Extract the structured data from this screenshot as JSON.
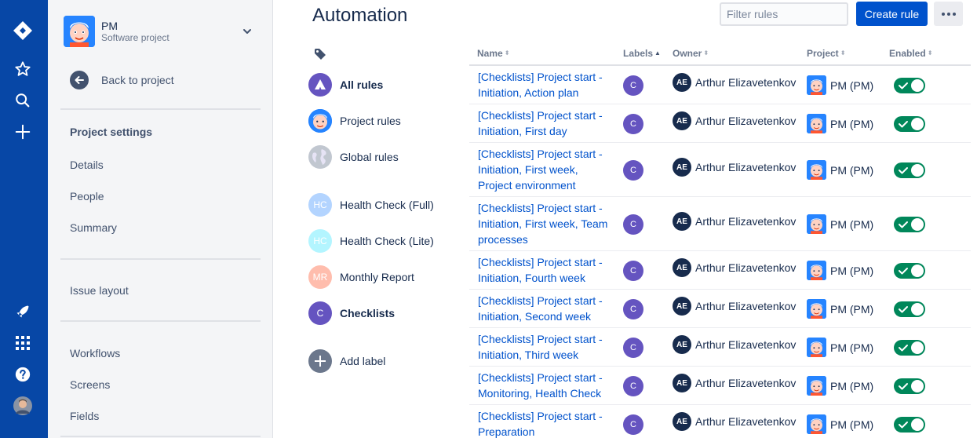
{
  "sidebar": {
    "project_name": "PM",
    "project_type": "Software project",
    "back_label": "Back to project",
    "section_heading": "Project settings",
    "items_a": [
      "Details",
      "People",
      "Summary"
    ],
    "issue_layout": "Issue layout",
    "items_b": [
      "Workflows",
      "Screens",
      "Fields"
    ]
  },
  "header": {
    "title": "Automation",
    "filter_placeholder": "Filter rules",
    "create_label": "Create rule"
  },
  "labels_panel": {
    "items": [
      {
        "label": "All rules",
        "icon": "automation-logo-icon",
        "bold": true
      },
      {
        "label": "Project rules",
        "icon": "project-avatar-icon",
        "bold": false
      },
      {
        "label": "Global rules",
        "icon": "globe-icon",
        "bold": false
      }
    ],
    "labels": [
      {
        "label": "Health Check (Full)",
        "initials": "HC",
        "color": "#b3d4ff",
        "bold": false
      },
      {
        "label": "Health Check (Lite)",
        "initials": "HC",
        "color": "#b3f5ff",
        "bold": false
      },
      {
        "label": "Monthly Report",
        "initials": "MR",
        "color": "#ffbdad",
        "bold": false
      },
      {
        "label": "Checklists",
        "initials": "C",
        "color": "#6554c0",
        "bold": true
      }
    ],
    "add_label": "Add label"
  },
  "table": {
    "columns": [
      "Name",
      "Labels",
      "Owner",
      "Project",
      "Enabled"
    ],
    "rows": [
      {
        "name": "[Checklists] Project start - Initiation, Action plan",
        "label": "C",
        "owner_initials": "AE",
        "owner": "Arthur Elizavetenkov",
        "project": "PM (PM)",
        "enabled": true
      },
      {
        "name": "[Checklists] Project start - Initiation, First day",
        "label": "C",
        "owner_initials": "AE",
        "owner": "Arthur Elizavetenkov",
        "project": "PM (PM)",
        "enabled": true
      },
      {
        "name": "[Checklists] Project start - Initiation, First week, Project environment",
        "label": "C",
        "owner_initials": "AE",
        "owner": "Arthur Elizavetenkov",
        "project": "PM (PM)",
        "enabled": true
      },
      {
        "name": "[Checklists] Project start - Initiation, First week, Team processes",
        "label": "C",
        "owner_initials": "AE",
        "owner": "Arthur Elizavetenkov",
        "project": "PM (PM)",
        "enabled": true
      },
      {
        "name": "[Checklists] Project start - Initiation, Fourth week",
        "label": "C",
        "owner_initials": "AE",
        "owner": "Arthur Elizavetenkov",
        "project": "PM (PM)",
        "enabled": true
      },
      {
        "name": "[Checklists] Project start - Initiation, Second week",
        "label": "C",
        "owner_initials": "AE",
        "owner": "Arthur Elizavetenkov",
        "project": "PM (PM)",
        "enabled": true
      },
      {
        "name": "[Checklists] Project start - Initiation, Third week",
        "label": "C",
        "owner_initials": "AE",
        "owner": "Arthur Elizavetenkov",
        "project": "PM (PM)",
        "enabled": true
      },
      {
        "name": "[Checklists] Project start - Monitoring, Health Check",
        "label": "C",
        "owner_initials": "AE",
        "owner": "Arthur Elizavetenkov",
        "project": "PM (PM)",
        "enabled": true
      },
      {
        "name": "[Checklists] Project start - Preparation",
        "label": "C",
        "owner_initials": "AE",
        "owner": "Arthur Elizavetenkov",
        "project": "PM (PM)",
        "enabled": true
      }
    ]
  }
}
